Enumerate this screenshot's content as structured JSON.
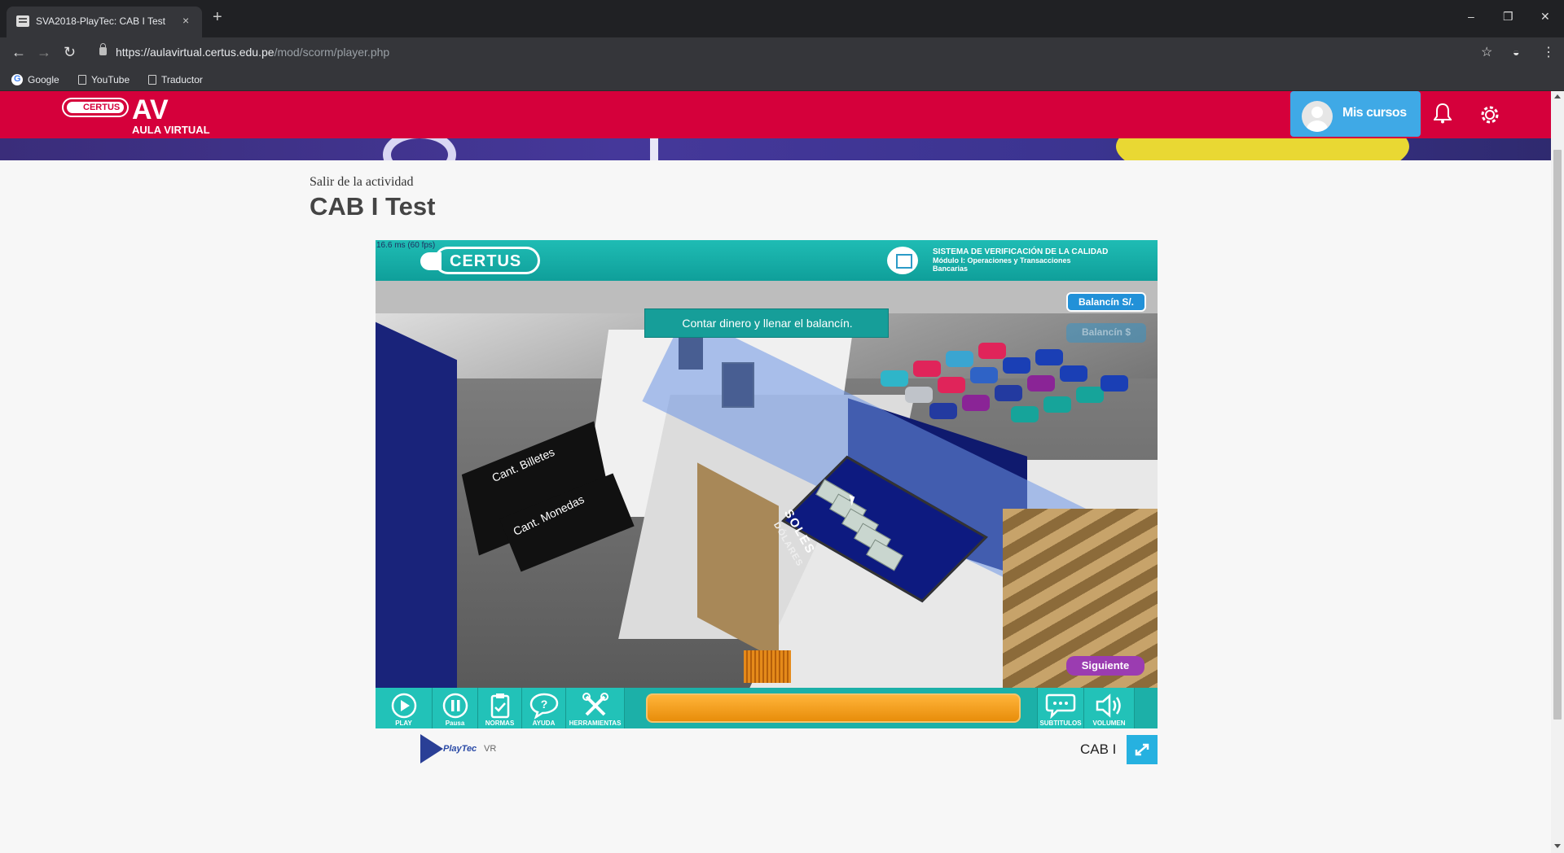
{
  "browser": {
    "tab_title": "SVA2018-PlayTec: CAB I Test",
    "tab_close": "×",
    "new_tab": "+",
    "url_host": "https://aulavirtual.certus.edu.pe",
    "url_path": "/mod/scorm/player.php",
    "bookmarks": [
      "Google",
      "YouTube",
      "Traductor"
    ],
    "window_controls": [
      "–",
      "❐",
      "✕"
    ]
  },
  "site": {
    "logo_pill": "CERTUS",
    "logo_av": "AV",
    "logo_sub": "AULA VIRTUAL",
    "mis_cursos": "Mis cursos"
  },
  "page": {
    "exit_link": "Salir de la actividad",
    "title": "CAB I Test"
  },
  "game": {
    "fps": "16.6 ms (60 fps)",
    "header_logo": "CERTUS",
    "system_title_1": "SISTEMA DE VERIFICACIÓN DE LA CALIDAD",
    "system_title_2": "Módulo I: Operaciones y Transacciones",
    "system_title_3": "Bancarias",
    "instruction": "Contar dinero y llenar el balancín.",
    "balancin_soles": "Balancín S/.",
    "balancin_dolares": "Balancín $",
    "siguiente": "Siguiente",
    "label_billetes": "Cant. Billetes",
    "label_monedas": "Cant. Monedas",
    "label_soles": "SOLES",
    "label_dolares": "DÓLARES",
    "toolbar": {
      "play": "PLAY",
      "pausa": "Pausa",
      "normas": "NORMAS",
      "ayuda": "AYUDA",
      "herramientas": "HERRAMIENTAS",
      "subtitulos": "SUBTITULOS",
      "volumen": "VOLUMEN"
    }
  },
  "footer": {
    "playtec": "PlayTec",
    "vr": "VR",
    "caption": "CAB I"
  },
  "colors": {
    "brand_red": "#d5003b",
    "teal": "#1cb0a8",
    "accent_blue": "#3fa9e6"
  }
}
